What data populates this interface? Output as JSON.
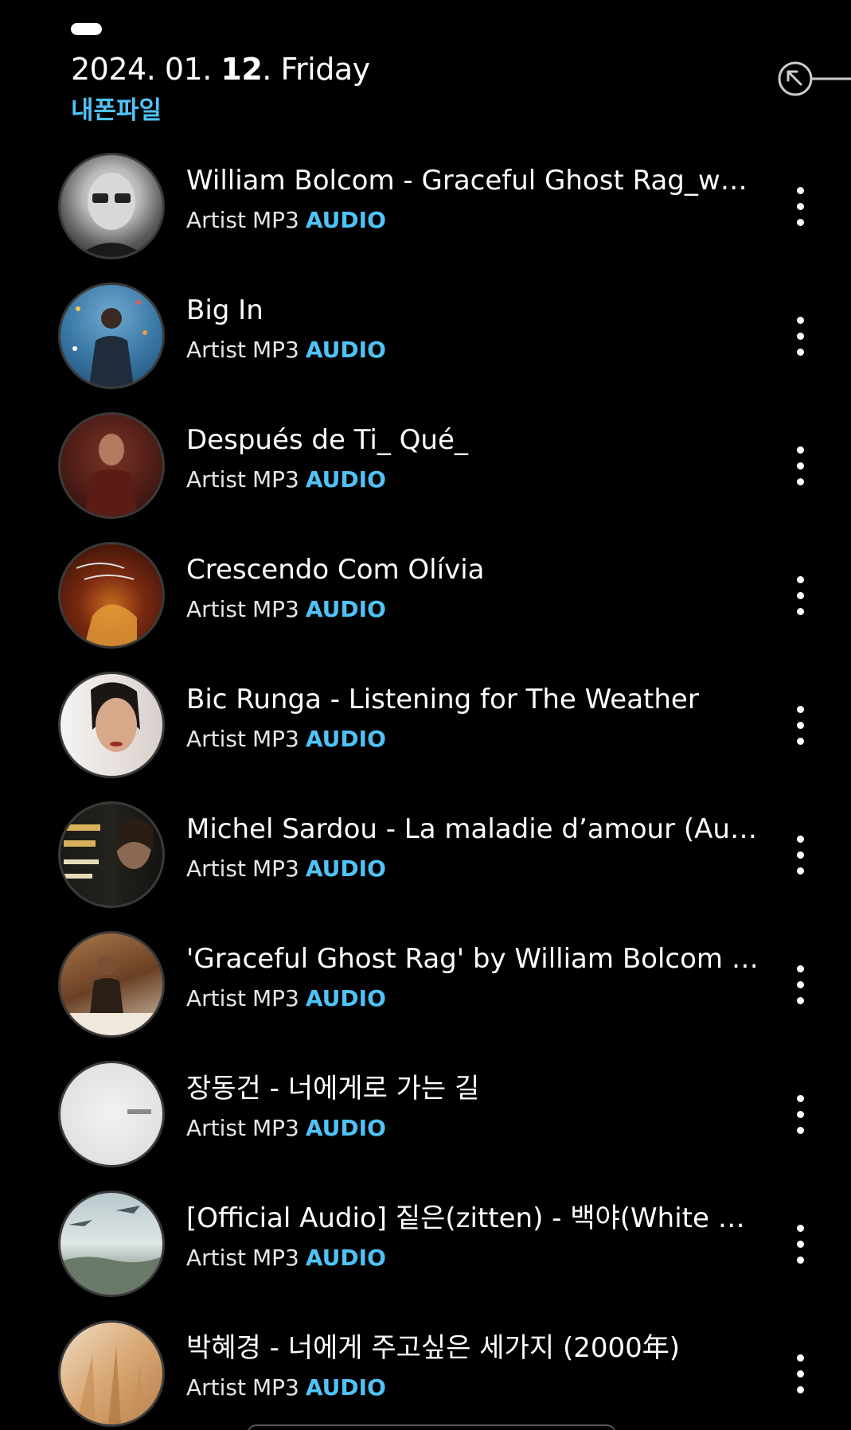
{
  "header": {
    "date_prefix": "2024. 01. ",
    "date_day": "12",
    "date_suffix": ". Friday",
    "subtitle": "내폰파일"
  },
  "colors": {
    "background": "#000000",
    "accent": "#4fc3f7",
    "text": "#ffffff"
  },
  "tracks": [
    {
      "title": "William Bolcom - Graceful Ghost Rag_wmv",
      "artist": "Artist",
      "format": "MP3",
      "type": "AUDIO",
      "thumb": "portrait-man-glasses"
    },
    {
      "title": "Big In",
      "artist": "Artist",
      "format": "MP3",
      "type": "AUDIO",
      "thumb": "album-blue-confetti"
    },
    {
      "title": "Después de Ti_ Qué_",
      "artist": "Artist",
      "format": "MP3",
      "type": "AUDIO",
      "thumb": "album-red-man"
    },
    {
      "title": "Crescendo Com Olívia",
      "artist": "Artist",
      "format": "MP3",
      "type": "AUDIO",
      "thumb": "album-dark-orange"
    },
    {
      "title": "Bic Runga - Listening for The Weather",
      "artist": "Artist",
      "format": "MP3",
      "type": "AUDIO",
      "thumb": "portrait-woman"
    },
    {
      "title": "Michel Sardou - La maladie d’amour (Audio ...",
      "artist": "Artist",
      "format": "MP3",
      "type": "AUDIO",
      "thumb": "album-yellow-text"
    },
    {
      "title": "'Graceful Ghost Rag' by William Bolcom - Ba...",
      "artist": "Artist",
      "format": "MP3",
      "type": "AUDIO",
      "thumb": "photo-pianist"
    },
    {
      "title": "장동건 - 너에게로 가는 길",
      "artist": "Artist",
      "format": "MP3",
      "type": "AUDIO",
      "thumb": "album-white"
    },
    {
      "title": "[Official Audio] 짙은(zitten) - 백야(White night)",
      "artist": "Artist",
      "format": "MP3",
      "type": "AUDIO",
      "thumb": "album-landscape"
    },
    {
      "title": "박혜경 - 너에게 주고싶은 세가지 (2000年)",
      "artist": "Artist",
      "format": "MP3",
      "type": "AUDIO",
      "thumb": "album-warm-field"
    }
  ],
  "icons": {
    "collapse": "arrow-up-left-circle-icon",
    "more": "more-vertical-icon"
  }
}
